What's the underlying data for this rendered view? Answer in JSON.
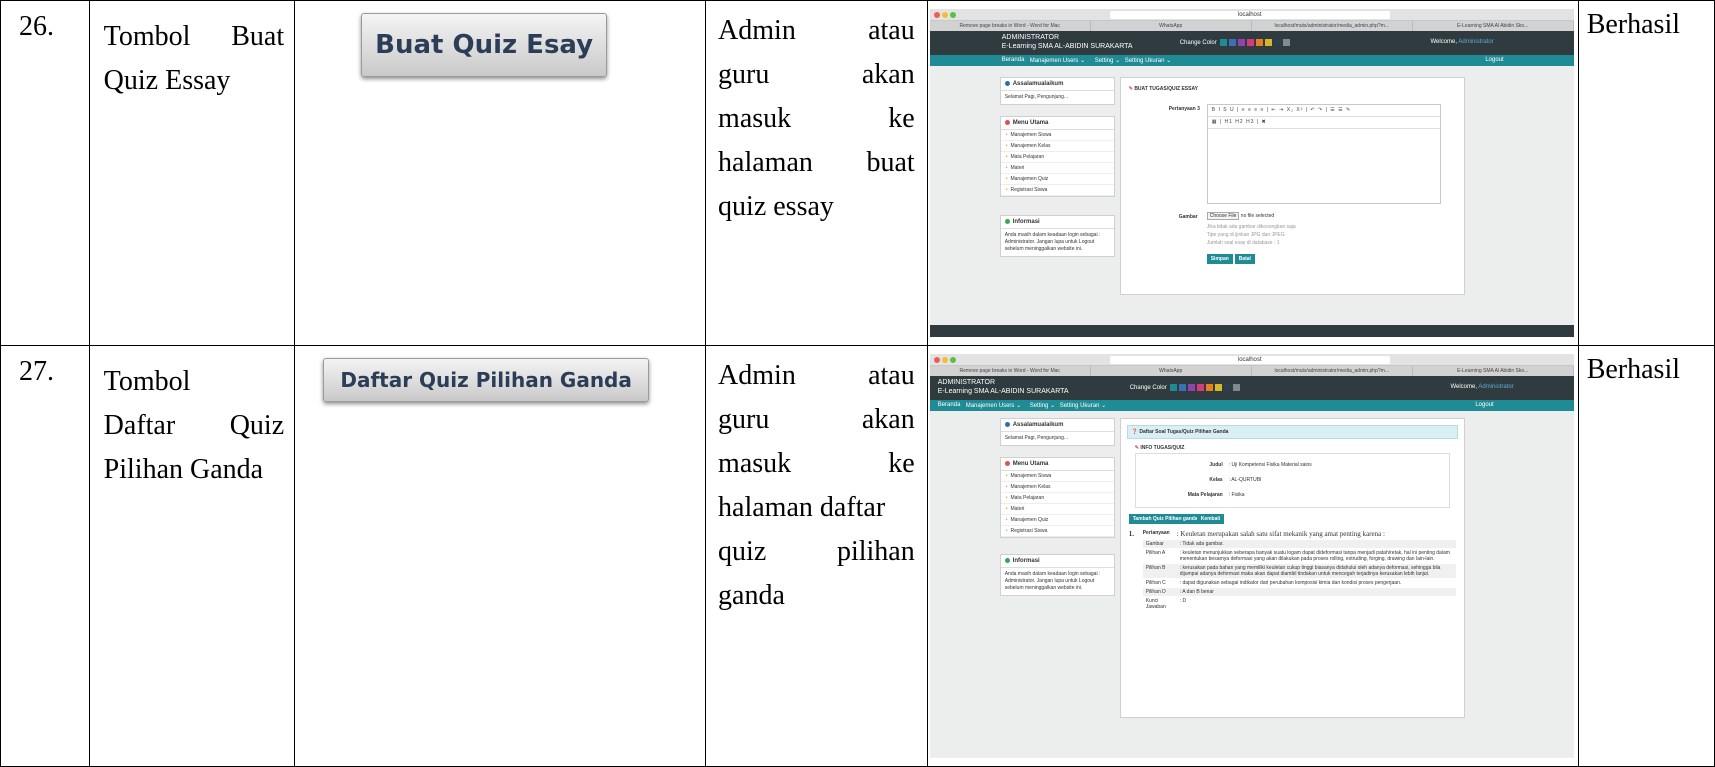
{
  "rows": [
    {
      "no": "26.",
      "name_lines": [
        [
          "Tombol",
          "Buat"
        ],
        [
          "Quiz Essay"
        ]
      ],
      "button_label": "Buat Quiz Esay",
      "desc_lines": [
        [
          "Admin",
          "atau"
        ],
        [
          "guru",
          "akan"
        ],
        [
          "masuk",
          "ke"
        ],
        [
          "halaman",
          "buat"
        ],
        [
          "quiz essay"
        ]
      ],
      "result": "Berhasil",
      "shot": {
        "url": "localhost",
        "tabs": [
          "Remove page breaks in Word - Word for Mac",
          "WhatsApp",
          "localhost/muts/administrator/media_admin.php?m...",
          "E-Learning SMA Al Abidin Sko..."
        ],
        "header_title_1": "ADMINISTRATOR",
        "header_title_2": "E-Learning SMA AL-ABIDIN SURAKARTA",
        "change_color": "Change Color",
        "welcome": "Welcome,",
        "welcome_user": "Administrator",
        "nav": [
          "Beranda",
          "Manajemen Users ⌄",
          "Setting ⌄",
          "Setting Ukuran ⌄"
        ],
        "logout": "Logout",
        "side_box1_title": "Assalamualaikum",
        "side_box1_text": "Selamat Pagi, Pengunjung...",
        "side_box2_title": "Menu Utama",
        "menu_items": [
          "Manajemen Siswa",
          "Manajemen Kelas",
          "Mata Pelajaran",
          "Materi",
          "Manajemen Quiz",
          "Registrasi Siswa"
        ],
        "side_box3_title": "Informasi",
        "info_text": "Anda masih dalam keadaan login sebagai : Administrator. Jangan lupa untuk Logout sebelum meninggalkan website ini.",
        "form_title": "BUAT TUGAS/QUIZ ESSAY",
        "label_pertanyaan": "Pertanyaan 3",
        "toolbar_1": "B I S U | ≡ ≡ ≡ ≡ | ⇤ ⇥ X₂ X² | ↶ ↷ | ☰ ☰ ✎",
        "toolbar_2": "▦ | H1 H2 H3 | ✖",
        "label_gambar": "Gambar",
        "file_button": "Choose File",
        "file_status": "no file selected",
        "hint_1": "Jika tidak ada gambar dikosongkan saja",
        "hint_2": "Tipe yang di ijinkan JPG dan JPEG",
        "hint_3": "Jumlah soal esay di database : 1",
        "btn_simpan": "Simpan",
        "btn_batal": "Batal"
      }
    },
    {
      "no": "27.",
      "name_lines": [
        [
          "Tombol"
        ],
        [
          "Daftar",
          "Quiz"
        ],
        [
          "Pilihan Ganda"
        ]
      ],
      "button_label": "Daftar Quiz Pilihan Ganda",
      "desc_lines": [
        [
          "Admin",
          "atau"
        ],
        [
          "guru",
          "akan"
        ],
        [
          "masuk",
          "ke"
        ],
        [
          "halaman daftar"
        ],
        [
          "quiz",
          "pilihan"
        ],
        [
          "ganda"
        ]
      ],
      "result": "Berhasil",
      "shot": {
        "url": "localhost",
        "tabs": [
          "Remove page breaks in Word - Word for Mac",
          "WhatsApp",
          "localhost/muts/administrator/media_admin.php?m...",
          "E-Learning SMA Al Abidin Sko..."
        ],
        "header_title_1": "ADMINISTRATOR",
        "header_title_2": "E-Learning SMA AL-ABIDIN SURAKARTA",
        "change_color": "Change Color",
        "welcome": "Welcome,",
        "welcome_user": "Administrator",
        "nav": [
          "Beranda",
          "Manajemen Users ⌄",
          "Setting ⌄",
          "Setting Ukuran ⌄"
        ],
        "logout": "Logout",
        "side_box1_title": "Assalamualaikum",
        "side_box1_text": "Selamat Pagi, Pengunjung...",
        "side_box2_title": "Menu Utama",
        "menu_items": [
          "Manajemen Siswa",
          "Manajemen Kelas",
          "Mata Pelajaran",
          "Materi",
          "Manajemen Quiz",
          "Registrasi Siswa"
        ],
        "side_box3_title": "Informasi",
        "info_text": "Anda masih dalam keadaan login sebagai : Administrator. Jangan lupa untuk Logout sebelum meninggalkan website ini.",
        "panel_title": "Daftar Soal Tugas/Quiz Pilihan Ganda",
        "info_heading": "INFO TUGAS/QUIZ",
        "info_rows": [
          {
            "k": "Judul",
            "v": ": Uji Kompetensi Fisika Material sains"
          },
          {
            "k": "Kelas",
            "v": ": AL-QURTUBI"
          },
          {
            "k": "Mata Pelajaran",
            "v": ": Fisika"
          }
        ],
        "btn_tambah": "Tambah Quiz Pilihan ganda",
        "btn_kembali": "Kembali",
        "q_number": "1.",
        "q_label": "Pertanyaan",
        "q_text": ": Keuletan merupakan salah satu sifat mekanik yang amat penting karena :",
        "q_rows": [
          {
            "k": "Gambar",
            "v": ": Tidak ada gambar."
          },
          {
            "k": "Pilihan A",
            "v": ": keuletan menunjukkan seberapa banyak suatu logam dapat dideformasi tanpa menjadi patah/retak, hal ini penting dalam menentukan besarnya deformasi yang akan dilakukan pada proses rolling, extruding, forging, drawing dan lain-lain."
          },
          {
            "k": "Pilihan B",
            "v": ": kerusakan pada bahan yang memiliki keuletan cukup tinggi biasanya didahului oleh adanya deformasi, sehingga bila dijumpai adanya deformasi maka akan dapat diambil tindakan untuk mencegah terjadinya kerusakan lebih lanjut."
          },
          {
            "k": "Pilihan C",
            "v": ": dapat digunakan sebagai indikator dari perubahan komposisi kimia dan kondisi proses pengerjaan."
          },
          {
            "k": "Pilihan D",
            "v": ": A dan B benar"
          },
          {
            "k": "Kunci Jawaban",
            "v": ": D"
          }
        ]
      }
    }
  ],
  "colors": {
    "header": "#2f3b3f",
    "nav": "#1f8b95",
    "swatches": [
      "#1f8b95",
      "#3b6fb6",
      "#8e44ad",
      "#d63a7b",
      "#e67e22",
      "#d4b72a",
      "#2c3e50",
      "#7f8c8d"
    ]
  }
}
